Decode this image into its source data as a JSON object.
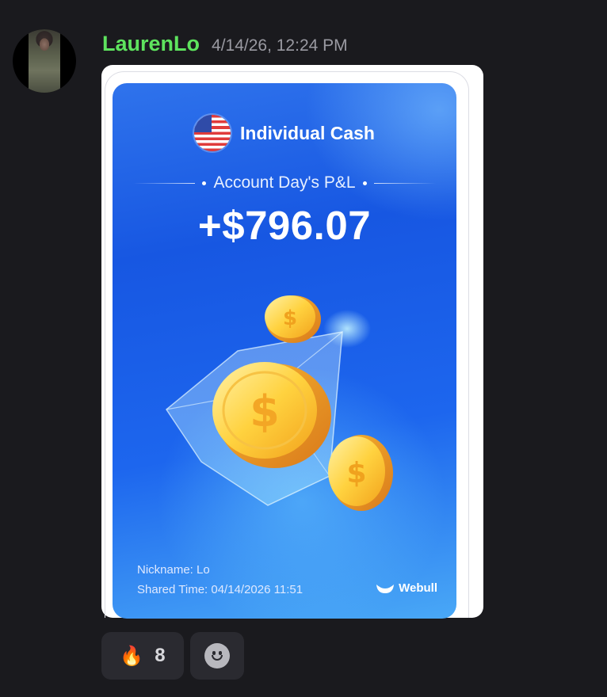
{
  "message": {
    "username": "LaurenLo",
    "timestamp": "4/14/26, 12:24 PM",
    "avatar_icon": "user-photo",
    "username_color": "#5ee35e"
  },
  "card": {
    "account_name": "Individual Cash",
    "flag_icon": "us-flag-icon",
    "subtitle": "Account Day's P&L",
    "amount": "+$796.07",
    "nickname": "Nickname: Lo",
    "shared_time": "Shared Time: 04/14/2026 11:51",
    "brand": "Webull",
    "brand_icon": "webull-logo-icon",
    "accent_color": "#1d5ee8"
  },
  "reactions": [
    {
      "emoji": "🔥",
      "icon": "fire-icon",
      "count": "8"
    },
    {
      "icon": "add-reaction-icon"
    }
  ]
}
